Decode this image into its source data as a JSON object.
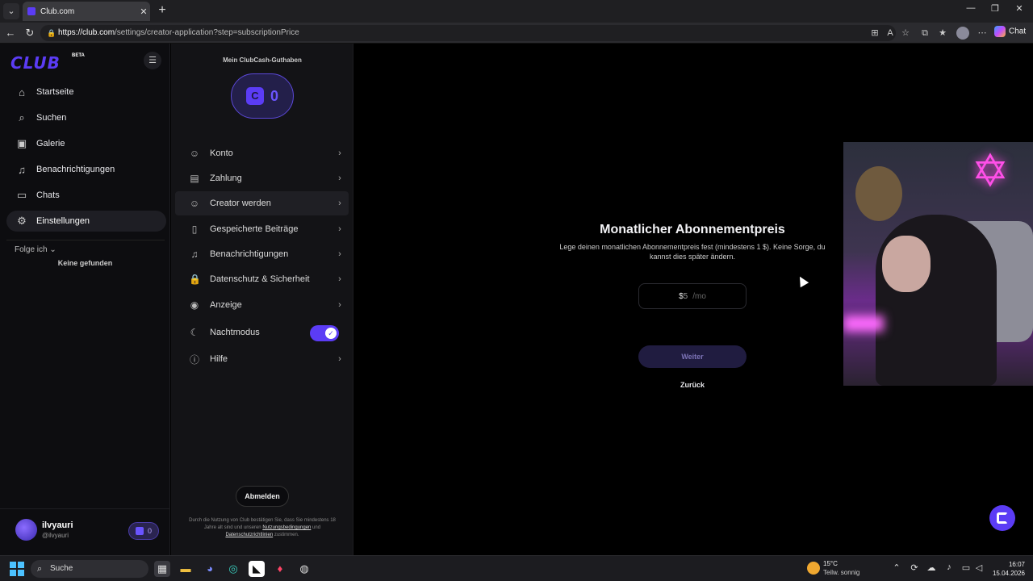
{
  "browser": {
    "tab_title": "Club.com",
    "url_host": "https://club.com",
    "url_path": "/settings/creator-application?step=subscriptionPrice",
    "chat_label": "Chat"
  },
  "sidebar": {
    "logo": "CLUB",
    "beta": "BETA",
    "items": [
      {
        "label": "Startseite",
        "icon": "home-icon"
      },
      {
        "label": "Suchen",
        "icon": "search-icon"
      },
      {
        "label": "Galerie",
        "icon": "gallery-icon"
      },
      {
        "label": "Benachrichtigungen",
        "icon": "bell-icon"
      },
      {
        "label": "Chats",
        "icon": "chat-icon"
      },
      {
        "label": "Einstellungen",
        "icon": "gear-icon",
        "active": true
      }
    ],
    "follow_label": "Folge ich",
    "none_found": "Keine gefunden",
    "user": {
      "name": "ilvyauri",
      "handle": "@ilvyauri",
      "cash": "0"
    }
  },
  "settings": {
    "cash_title": "Mein ClubCash-Guthaben",
    "cash_value": "0",
    "menu": [
      {
        "label": "Konto",
        "icon": "user-icon"
      },
      {
        "label": "Zahlung",
        "icon": "wallet-icon"
      },
      {
        "label": "Creator werden",
        "icon": "user-icon",
        "active": true
      },
      {
        "label": "Gespeicherte Beiträge",
        "icon": "bookmark-icon"
      },
      {
        "label": "Benachrichtigungen",
        "icon": "bell-icon"
      },
      {
        "label": "Datenschutz & Sicherheit",
        "icon": "lock-icon"
      },
      {
        "label": "Anzeige",
        "icon": "eye-icon"
      },
      {
        "label": "Nachtmodus",
        "icon": "moon-icon",
        "toggle": true
      },
      {
        "label": "Hilfe",
        "icon": "info-icon"
      }
    ],
    "logout": "Abmelden",
    "legal_1": "Durch die Nutzung von Club bestätigen Sie, dass Sie mindestens 18 Jahre alt sind und unseren",
    "legal_terms": "Nutzungsbedingungen",
    "legal_and": "und",
    "legal_privacy": "Datenschutzrichtlinien",
    "legal_end": "zustimmen."
  },
  "main": {
    "title": "Monatlicher Abonnementpreis",
    "description": "Lege deinen monatlichen Abonnementpreis fest (mindestens 1 $). Keine Sorge, du kannst dies später ändern.",
    "currency": "$",
    "price_placeholder": "5",
    "per": "/mo",
    "next": "Weiter",
    "back": "Zurück"
  },
  "taskbar": {
    "search": "Suche",
    "weather_temp": "15°C",
    "weather_cond": "Teilw. sonnig",
    "time": "16:07",
    "date": "15.04.2026"
  },
  "colors": {
    "accent": "#5b3cf5"
  }
}
